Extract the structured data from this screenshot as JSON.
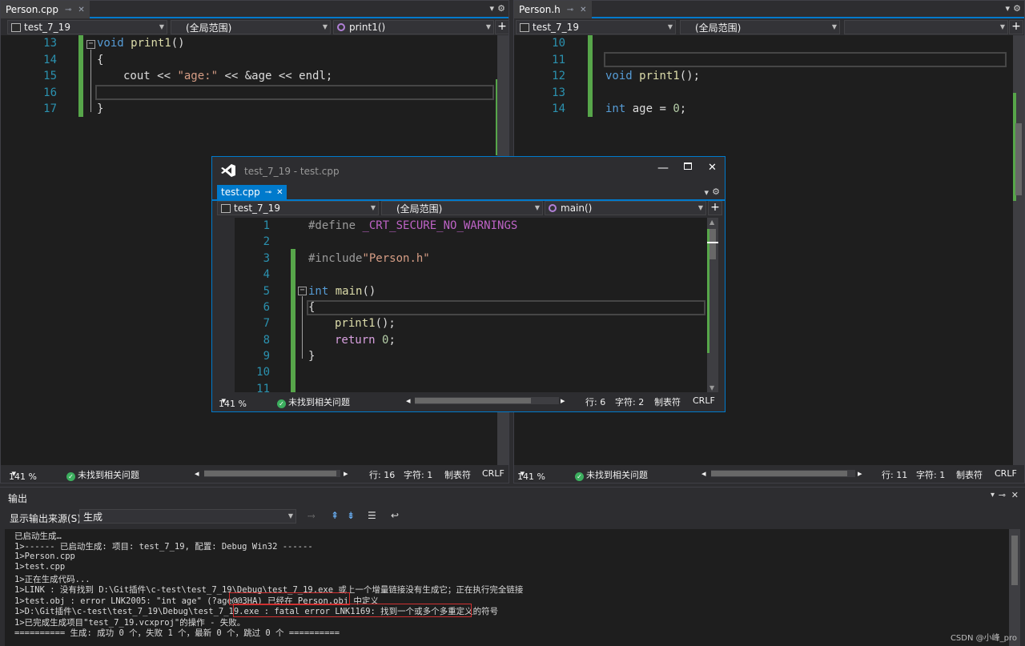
{
  "left_pane": {
    "tab_label": "Person.cpp",
    "project": "test_7_19",
    "scope": "(全局范围)",
    "member": "print1()",
    "line_numbers": [
      "13",
      "14",
      "15",
      "16",
      "17"
    ],
    "code": {
      "l13_kw": "void",
      "l13_fn": "print1",
      "l13_rest": "()",
      "l14": "{",
      "l15_a": "cout << ",
      "l15_str": "\"age:\"",
      "l15_b": " << &age << endl;",
      "l17": "}"
    },
    "status": {
      "zoom": "141 %",
      "issues": "未找到相关问题",
      "line": "行: 16",
      "char": "字符: 1",
      "tabs": "制表符",
      "eol": "CRLF"
    }
  },
  "right_pane": {
    "tab_label": "Person.h",
    "project": "test_7_19",
    "scope": "(全局范围)",
    "member": "",
    "line_numbers": [
      "10",
      "11",
      "12",
      "13",
      "14"
    ],
    "code": {
      "l12_kw": "void",
      "l12_fn": "print1",
      "l12_rest": "();",
      "l14_kw": "int",
      "l14_rest": " age = ",
      "l14_num": "0",
      "l14_end": ";"
    },
    "status": {
      "zoom": "141 %",
      "issues": "未找到相关问题",
      "line": "行: 11",
      "char": "字符: 1",
      "tabs": "制表符",
      "eol": "CRLF"
    }
  },
  "float_window": {
    "title": "test_7_19 - test.cpp",
    "tab_label": "test.cpp",
    "project": "test_7_19",
    "scope": "(全局范围)",
    "member": "main()",
    "line_numbers": [
      "1",
      "2",
      "3",
      "4",
      "5",
      "6",
      "7",
      "8",
      "9",
      "10",
      "11"
    ],
    "code": {
      "l1_mac": "#define",
      "l1_rest": " _CRT_SECURE_NO_WARNINGS",
      "l3_mac": "#include",
      "l3_str": "\"Person.h\"",
      "l5_kw": "int",
      "l5_fn": " main",
      "l5_rest": "()",
      "l6": "{",
      "l7_fn": "print1",
      "l7_rest": "();",
      "l8_ret": "return",
      "l8_num": " 0",
      "l8_end": ";",
      "l9": "}"
    },
    "status": {
      "zoom": "141 %",
      "issues": "未找到相关问题",
      "line": "行: 6",
      "char": "字符: 2",
      "tabs": "制表符",
      "eol": "CRLF"
    }
  },
  "output": {
    "title": "输出",
    "source_label": "显示输出来源(S):",
    "source_value": "生成",
    "lines": [
      "已启动生成…",
      "1>------ 已启动生成: 项目: test_7_19, 配置: Debug Win32 ------",
      "1>Person.cpp",
      "1>test.cpp",
      "1>正在生成代码...",
      "1>LINK : 没有找到 D:\\Git插件\\c-test\\test_7_19\\Debug\\test_7_19.exe 或上一个增量链接没有生成它；正在执行完全链接",
      "1>test.obj : error LNK2005: \"int age\" (?age@@3HA) 已经在 Person.obj 中定义",
      "1>D:\\Git插件\\c-test\\test_7_19\\Debug\\test_7_19.exe : fatal error LNK1169: 找到一个或多个多重定义的符号",
      "1>已完成生成项目\"test_7_19.vcxproj\"的操作 - 失败。",
      "========== 生成: 成功 0 个，失败 1 个，最新 0 个，跳过 0 个 =========="
    ]
  },
  "watermark": "CSDN @小峰_pro",
  "colors": {
    "accent": "#007acc",
    "error_box": "#d03030",
    "change_bar": "#57a64a"
  }
}
